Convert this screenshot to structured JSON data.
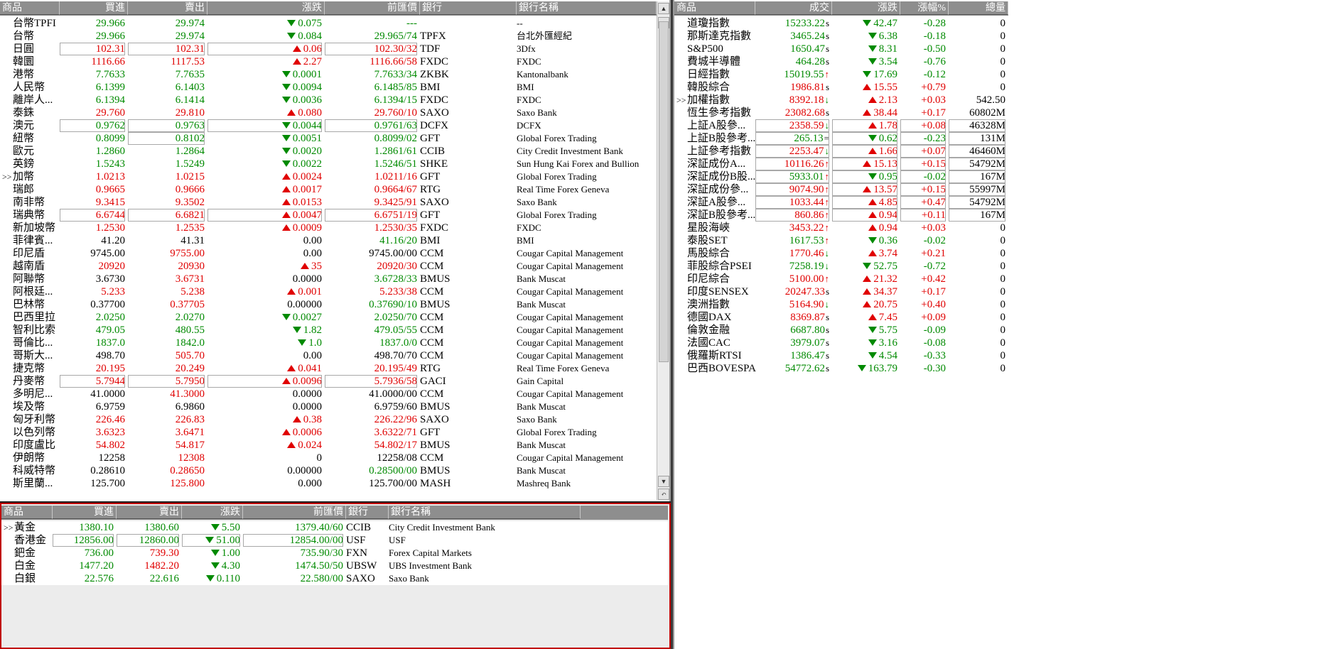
{
  "fx": {
    "headers": [
      "商品",
      "買進",
      "賣出",
      "漲跌",
      "前匯價",
      "銀行",
      "銀行名稱"
    ],
    "rows": [
      {
        "name": "台幣TPFI",
        "bid": "29.966",
        "ask": "29.974",
        "chg": "0.075",
        "dir": "down",
        "prev": "---",
        "bank": "",
        "bankname": "--",
        "color": "g"
      },
      {
        "name": "台幣",
        "bid": "29.966",
        "ask": "29.974",
        "chg": "0.084",
        "dir": "down",
        "prev": "29.965/74",
        "bank": "TPFX",
        "bankname": "台北外匯經紀",
        "color": "g"
      },
      {
        "name": "日圓",
        "bid": "102.31",
        "ask": "102.31",
        "chg": "0.06",
        "dir": "up",
        "prev": "102.30/32",
        "bank": "TDF",
        "bankname": "3Dfx",
        "color": "rd",
        "boxed": true
      },
      {
        "name": "韓圜",
        "bid": "1116.66",
        "ask": "1117.53",
        "chg": "2.27",
        "dir": "up",
        "prev": "1116.66/58",
        "bank": "FXDC",
        "bankname": "FXDC",
        "color": "rd"
      },
      {
        "name": "港幣",
        "bid": "7.7633",
        "ask": "7.7635",
        "chg": "0.0001",
        "dir": "down",
        "prev": "7.7633/34",
        "bank": "ZKBK",
        "bankname": "Kantonalbank",
        "color": "g"
      },
      {
        "name": "人民幣",
        "bid": "6.1399",
        "ask": "6.1403",
        "chg": "0.0094",
        "dir": "down",
        "prev": "6.1485/85",
        "bank": "BMI",
        "bankname": "BMI",
        "color": "g"
      },
      {
        "name": "離岸人...",
        "bid": "6.1394",
        "ask": "6.1414",
        "chg": "0.0036",
        "dir": "down",
        "prev": "6.1394/15",
        "bank": "FXDC",
        "bankname": "FXDC",
        "color": "g"
      },
      {
        "name": "泰銖",
        "bid": "29.760",
        "ask": "29.810",
        "chg": "0.080",
        "dir": "up",
        "prev": "29.760/10",
        "bank": "SAXO",
        "bankname": "Saxo Bank",
        "color": "rd"
      },
      {
        "name": "澳元",
        "bid": "0.9762",
        "ask": "0.9763",
        "chg": "0.0044",
        "dir": "down",
        "prev": "0.9761/63",
        "bank": "DCFX",
        "bankname": "DCFX",
        "color": "g",
        "boxed": true
      },
      {
        "name": "紐幣",
        "bid": "0.8099",
        "ask": "0.8102",
        "chg": "0.0051",
        "dir": "down",
        "prev": "0.8099/02",
        "bank": "GFT",
        "bankname": "Global Forex Trading",
        "color": "g",
        "boxedAsk": true
      },
      {
        "name": "歐元",
        "bid": "1.2860",
        "ask": "1.2864",
        "chg": "0.0020",
        "dir": "down",
        "prev": "1.2861/61",
        "bank": "CCIB",
        "bankname": "City Credit Investment Bank",
        "color": "g"
      },
      {
        "name": "英鎊",
        "bid": "1.5243",
        "ask": "1.5249",
        "chg": "0.0022",
        "dir": "down",
        "prev": "1.5246/51",
        "bank": "SHKE",
        "bankname": "Sun Hung Kai Forex and Bullion",
        "color": "g"
      },
      {
        "name": "加幣",
        "bid": "1.0213",
        "ask": "1.0215",
        "chg": "0.0024",
        "dir": "up",
        "prev": "1.0211/16",
        "bank": "GFT",
        "bankname": "Global Forex Trading",
        "color": "rd",
        "marker": ">>"
      },
      {
        "name": "瑞郎",
        "bid": "0.9665",
        "ask": "0.9666",
        "chg": "0.0017",
        "dir": "up",
        "prev": "0.9664/67",
        "bank": "RTG",
        "bankname": "Real Time Forex Geneva",
        "color": "rd"
      },
      {
        "name": "南非幣",
        "bid": "9.3415",
        "ask": "9.3502",
        "chg": "0.0153",
        "dir": "up",
        "prev": "9.3425/91",
        "bank": "SAXO",
        "bankname": "Saxo Bank",
        "color": "rd"
      },
      {
        "name": "瑞典幣",
        "bid": "6.6744",
        "ask": "6.6821",
        "chg": "0.0047",
        "dir": "up",
        "prev": "6.6751/19",
        "bank": "GFT",
        "bankname": "Global Forex Trading",
        "color": "rd",
        "boxed": true
      },
      {
        "name": "新加坡幣",
        "bid": "1.2530",
        "ask": "1.2535",
        "chg": "0.0009",
        "dir": "up",
        "prev": "1.2530/35",
        "bank": "FXDC",
        "bankname": "FXDC",
        "color": "rd"
      },
      {
        "name": "菲律賓...",
        "bid": "41.20",
        "ask": "41.31",
        "chg": "0.00",
        "dir": "none",
        "prev": "41.16/20",
        "bank": "BMI",
        "bankname": "BMI",
        "color": "k",
        "prevColor": "g"
      },
      {
        "name": "印尼盾",
        "bid": "9745.00",
        "ask": "9755.00",
        "chg": "0.00",
        "dir": "none",
        "prev": "9745.00/00",
        "bank": "CCM",
        "bankname": "Cougar Capital Management",
        "color": "k",
        "askColor": "rd"
      },
      {
        "name": "越南盾",
        "bid": "20920",
        "ask": "20930",
        "chg": "35",
        "dir": "up",
        "prev": "20920/30",
        "bank": "CCM",
        "bankname": "Cougar Capital Management",
        "color": "rd"
      },
      {
        "name": "阿聯幣",
        "bid": "3.6730",
        "ask": "3.6731",
        "chg": "0.0000",
        "dir": "none",
        "prev": "3.6728/33",
        "bank": "BMUS",
        "bankname": "Bank Muscat",
        "color": "k",
        "askColor": "rd",
        "prevColor": "g"
      },
      {
        "name": "阿根廷...",
        "bid": "5.233",
        "ask": "5.238",
        "chg": "0.001",
        "dir": "up",
        "prev": "5.233/38",
        "bank": "CCM",
        "bankname": "Cougar Capital Management",
        "color": "rd"
      },
      {
        "name": "巴林幣",
        "bid": "0.37700",
        "ask": "0.37705",
        "chg": "0.00000",
        "dir": "none",
        "prev": "0.37690/10",
        "bank": "BMUS",
        "bankname": "Bank Muscat",
        "color": "k",
        "askColor": "rd",
        "prevColor": "g"
      },
      {
        "name": "巴西里拉",
        "bid": "2.0250",
        "ask": "2.0270",
        "chg": "0.0027",
        "dir": "down",
        "prev": "2.0250/70",
        "bank": "CCM",
        "bankname": "Cougar Capital Management",
        "color": "g"
      },
      {
        "name": "智利比索",
        "bid": "479.05",
        "ask": "480.55",
        "chg": "1.82",
        "dir": "down",
        "prev": "479.05/55",
        "bank": "CCM",
        "bankname": "Cougar Capital Management",
        "color": "g"
      },
      {
        "name": "哥倫比...",
        "bid": "1837.0",
        "ask": "1842.0",
        "chg": "1.0",
        "dir": "down",
        "prev": "1837.0/0",
        "bank": "CCM",
        "bankname": "Cougar Capital Management",
        "color": "g"
      },
      {
        "name": "哥斯大...",
        "bid": "498.70",
        "ask": "505.70",
        "chg": "0.00",
        "dir": "none",
        "prev": "498.70/70",
        "bank": "CCM",
        "bankname": "Cougar Capital Management",
        "color": "k",
        "askColor": "rd"
      },
      {
        "name": "捷克幣",
        "bid": "20.195",
        "ask": "20.249",
        "chg": "0.041",
        "dir": "up",
        "prev": "20.195/49",
        "bank": "RTG",
        "bankname": "Real Time Forex Geneva",
        "color": "rd"
      },
      {
        "name": "丹麥幣",
        "bid": "5.7944",
        "ask": "5.7950",
        "chg": "0.0096",
        "dir": "up",
        "prev": "5.7936/58",
        "bank": "GACI",
        "bankname": "Gain Capital",
        "color": "rd",
        "boxed": true
      },
      {
        "name": "多明尼...",
        "bid": "41.0000",
        "ask": "41.3000",
        "chg": "0.0000",
        "dir": "none",
        "prev": "41.0000/00",
        "bank": "CCM",
        "bankname": "Cougar Capital Management",
        "color": "k",
        "askColor": "rd"
      },
      {
        "name": "埃及幣",
        "bid": "6.9759",
        "ask": "6.9860",
        "chg": "0.0000",
        "dir": "none",
        "prev": "6.9759/60",
        "bank": "BMUS",
        "bankname": "Bank Muscat",
        "color": "k"
      },
      {
        "name": "匈牙利幣",
        "bid": "226.46",
        "ask": "226.83",
        "chg": "0.38",
        "dir": "up",
        "prev": "226.22/96",
        "bank": "SAXO",
        "bankname": "Saxo Bank",
        "color": "rd"
      },
      {
        "name": "以色列幣",
        "bid": "3.6323",
        "ask": "3.6471",
        "chg": "0.0006",
        "dir": "up",
        "prev": "3.6322/71",
        "bank": "GFT",
        "bankname": "Global Forex Trading",
        "color": "rd"
      },
      {
        "name": "印度盧比",
        "bid": "54.802",
        "ask": "54.817",
        "chg": "0.024",
        "dir": "up",
        "prev": "54.802/17",
        "bank": "BMUS",
        "bankname": "Bank Muscat",
        "color": "rd"
      },
      {
        "name": "伊朗幣",
        "bid": "12258",
        "ask": "12308",
        "chg": "0",
        "dir": "none",
        "prev": "12258/08",
        "bank": "CCM",
        "bankname": "Cougar Capital Management",
        "color": "k",
        "askColor": "rd"
      },
      {
        "name": "科威特幣",
        "bid": "0.28610",
        "ask": "0.28650",
        "chg": "0.00000",
        "dir": "none",
        "prev": "0.28500/00",
        "bank": "BMUS",
        "bankname": "Bank Muscat",
        "color": "k",
        "askColor": "rd",
        "prevColor": "g"
      },
      {
        "name": "斯里蘭...",
        "bid": "125.700",
        "ask": "125.800",
        "chg": "0.000",
        "dir": "none",
        "prev": "125.700/00",
        "bank": "MASH",
        "bankname": "Mashreq Bank",
        "color": "k",
        "askColor": "rd"
      }
    ]
  },
  "metals": {
    "headers": [
      "商品",
      "買進",
      "賣出",
      "漲跌",
      "前匯價",
      "銀行",
      "銀行名稱"
    ],
    "rows": [
      {
        "name": "黃金",
        "bid": "1380.10",
        "ask": "1380.60",
        "chg": "5.50",
        "dir": "down",
        "prev": "1379.40/60",
        "bank": "CCIB",
        "bankname": "City Credit Investment Bank",
        "color": "g",
        "marker": ">>"
      },
      {
        "name": "香港金",
        "bid": "12856.00",
        "ask": "12860.00",
        "chg": "51.00",
        "dir": "down",
        "prev": "12854.00/00",
        "bank": "USF",
        "bankname": "USF",
        "color": "g",
        "boxed": true
      },
      {
        "name": "鈀金",
        "bid": "736.00",
        "ask": "739.30",
        "chg": "1.00",
        "dir": "down",
        "prev": "735.90/30",
        "bank": "FXN",
        "bankname": "Forex Capital Markets",
        "color": "g",
        "askColor": "rd"
      },
      {
        "name": "白金",
        "bid": "1477.20",
        "ask": "1482.20",
        "chg": "4.30",
        "dir": "down",
        "prev": "1474.50/50",
        "bank": "UBSW",
        "bankname": "UBS Investment Bank",
        "color": "g",
        "askColor": "rd"
      },
      {
        "name": "白銀",
        "bid": "22.576",
        "ask": "22.616",
        "chg": "0.110",
        "dir": "down",
        "prev": "22.580/00",
        "bank": "SAXO",
        "bankname": "Saxo Bank",
        "color": "g"
      }
    ]
  },
  "indices": {
    "headers": [
      "商品",
      "成交",
      "漲跌",
      "漲幅%",
      "總量"
    ],
    "rows": [
      {
        "name": "道瓊指數",
        "last": "15233.22",
        "flag": "s",
        "chg": "42.47",
        "dir": "down",
        "pct": "-0.28",
        "vol": "0",
        "color": "g"
      },
      {
        "name": "那斯達克指數",
        "last": "3465.24",
        "flag": "s",
        "chg": "6.38",
        "dir": "down",
        "pct": "-0.18",
        "vol": "0",
        "color": "g"
      },
      {
        "name": "S&P500",
        "last": "1650.47",
        "flag": "s",
        "chg": "8.31",
        "dir": "down",
        "pct": "-0.50",
        "vol": "0",
        "color": "g"
      },
      {
        "name": "費城半導體",
        "last": "464.28",
        "flag": "s",
        "chg": "3.54",
        "dir": "down",
        "pct": "-0.76",
        "vol": "0",
        "color": "g"
      },
      {
        "name": "日經指數",
        "last": "15019.55",
        "flag": "↑",
        "chg": "17.69",
        "dir": "down",
        "pct": "-0.12",
        "vol": "0",
        "color": "g"
      },
      {
        "name": "韓股綜合",
        "last": "1986.81",
        "flag": "s",
        "chg": "15.55",
        "dir": "up",
        "pct": "+0.79",
        "vol": "0",
        "color": "rd"
      },
      {
        "name": "加權指數",
        "last": "8392.18",
        "flag": "↓",
        "chg": "2.13",
        "dir": "up",
        "pct": "+0.03",
        "vol": "542.50",
        "color": "rd",
        "marker": ">>"
      },
      {
        "name": "恆生參考指數",
        "last": "23082.68",
        "flag": "s",
        "chg": "38.44",
        "dir": "up",
        "pct": "+0.17",
        "vol": "60802M",
        "color": "rd"
      },
      {
        "name": "上証A股參...",
        "last": "2358.59",
        "flag": "↓",
        "chg": "1.78",
        "dir": "up",
        "pct": "+0.08",
        "vol": "46328M",
        "color": "rd",
        "boxed": true
      },
      {
        "name": "上証B股參考...",
        "last": "265.13",
        "flag": "=",
        "chg": "0.62",
        "dir": "down",
        "pct": "-0.23",
        "vol": "131M",
        "color": "g",
        "boxed": true
      },
      {
        "name": "上証參考指數",
        "last": "2253.47",
        "flag": "↓",
        "chg": "1.66",
        "dir": "up",
        "pct": "+0.07",
        "vol": "46460M",
        "color": "rd",
        "boxed": true
      },
      {
        "name": "深証成份A...",
        "last": "10116.26",
        "flag": "↑",
        "chg": "15.13",
        "dir": "up",
        "pct": "+0.15",
        "vol": "54792M",
        "color": "rd",
        "boxed": true
      },
      {
        "name": "深証成份B股...",
        "last": "5933.01",
        "flag": "↑",
        "chg": "0.95",
        "dir": "down",
        "pct": "-0.02",
        "vol": "167M",
        "color": "g",
        "boxed": true
      },
      {
        "name": "深証成份參...",
        "last": "9074.90",
        "flag": "↑",
        "chg": "13.57",
        "dir": "up",
        "pct": "+0.15",
        "vol": "55997M",
        "color": "rd",
        "boxed": true
      },
      {
        "name": "深証A股參...",
        "last": "1033.44",
        "flag": "↑",
        "chg": "4.85",
        "dir": "up",
        "pct": "+0.47",
        "vol": "54792M",
        "color": "rd",
        "boxed": true
      },
      {
        "name": "深証B股參考...",
        "last": "860.86",
        "flag": "↑",
        "chg": "0.94",
        "dir": "up",
        "pct": "+0.11",
        "vol": "167M",
        "color": "rd",
        "boxed": true
      },
      {
        "name": "星股海峽",
        "last": "3453.22",
        "flag": "↑",
        "chg": "0.94",
        "dir": "up",
        "pct": "+0.03",
        "vol": "0",
        "color": "rd"
      },
      {
        "name": "泰股SET",
        "last": "1617.53",
        "flag": "↑",
        "chg": "0.36",
        "dir": "down",
        "pct": "-0.02",
        "vol": "0",
        "color": "g"
      },
      {
        "name": "馬股綜合",
        "last": "1770.46",
        "flag": "↓",
        "chg": "3.74",
        "dir": "up",
        "pct": "+0.21",
        "vol": "0",
        "color": "rd"
      },
      {
        "name": "菲股綜合PSEI",
        "last": "7258.19",
        "flag": "↓",
        "chg": "52.75",
        "dir": "down",
        "pct": "-0.72",
        "vol": "0",
        "color": "g"
      },
      {
        "name": "印尼綜合",
        "last": "5100.00",
        "flag": "↑",
        "chg": "21.32",
        "dir": "up",
        "pct": "+0.42",
        "vol": "0",
        "color": "rd"
      },
      {
        "name": "印度SENSEX",
        "last": "20247.33",
        "flag": "s",
        "chg": "34.37",
        "dir": "up",
        "pct": "+0.17",
        "vol": "0",
        "color": "rd"
      },
      {
        "name": "澳洲指數",
        "last": "5164.90",
        "flag": "↓",
        "chg": "20.75",
        "dir": "up",
        "pct": "+0.40",
        "vol": "0",
        "color": "rd"
      },
      {
        "name": "德國DAX",
        "last": "8369.87",
        "flag": "s",
        "chg": "7.45",
        "dir": "up",
        "pct": "+0.09",
        "vol": "0",
        "color": "rd"
      },
      {
        "name": "倫敦金融",
        "last": "6687.80",
        "flag": "s",
        "chg": "5.75",
        "dir": "down",
        "pct": "-0.09",
        "vol": "0",
        "color": "g"
      },
      {
        "name": "法國CAC",
        "last": "3979.07",
        "flag": "s",
        "chg": "3.16",
        "dir": "down",
        "pct": "-0.08",
        "vol": "0",
        "color": "g"
      },
      {
        "name": "俄羅斯RTSI",
        "last": "1386.47",
        "flag": "s",
        "chg": "4.54",
        "dir": "down",
        "pct": "-0.33",
        "vol": "0",
        "color": "g"
      },
      {
        "name": "巴西BOVESPA",
        "last": "54772.62",
        "flag": "s",
        "chg": "163.79",
        "dir": "down",
        "pct": "-0.30",
        "vol": "0",
        "color": "g"
      }
    ]
  },
  "colors": {
    "up": "#e00000",
    "down": "#008a00",
    "header_bg": "#8e8e8e",
    "metals_border": "#c00000"
  },
  "icons": {
    "scroll_up": "triangle-up-icon",
    "scroll_down": "triangle-down-icon",
    "scroll_reset": "refresh-icon"
  }
}
